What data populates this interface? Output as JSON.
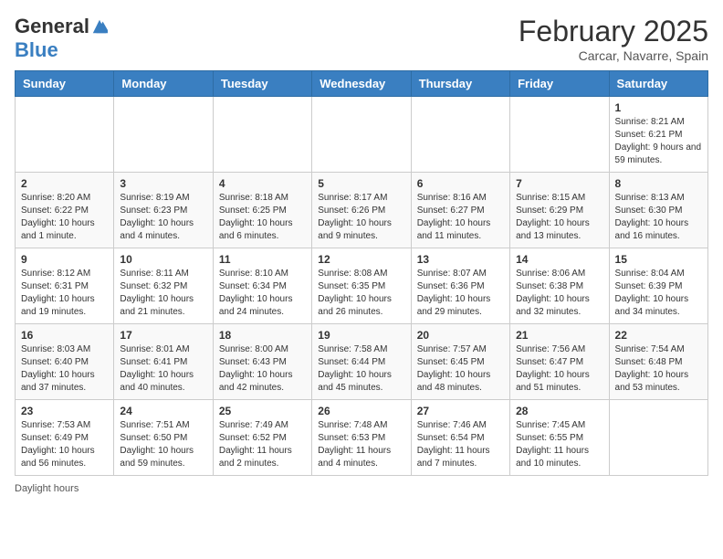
{
  "header": {
    "logo_general": "General",
    "logo_blue": "Blue",
    "month_title": "February 2025",
    "location": "Carcar, Navarre, Spain"
  },
  "calendar": {
    "days_of_week": [
      "Sunday",
      "Monday",
      "Tuesday",
      "Wednesday",
      "Thursday",
      "Friday",
      "Saturday"
    ],
    "weeks": [
      [
        {
          "day": "",
          "info": ""
        },
        {
          "day": "",
          "info": ""
        },
        {
          "day": "",
          "info": ""
        },
        {
          "day": "",
          "info": ""
        },
        {
          "day": "",
          "info": ""
        },
        {
          "day": "",
          "info": ""
        },
        {
          "day": "1",
          "info": "Sunrise: 8:21 AM\nSunset: 6:21 PM\nDaylight: 9 hours and 59 minutes."
        }
      ],
      [
        {
          "day": "2",
          "info": "Sunrise: 8:20 AM\nSunset: 6:22 PM\nDaylight: 10 hours and 1 minute."
        },
        {
          "day": "3",
          "info": "Sunrise: 8:19 AM\nSunset: 6:23 PM\nDaylight: 10 hours and 4 minutes."
        },
        {
          "day": "4",
          "info": "Sunrise: 8:18 AM\nSunset: 6:25 PM\nDaylight: 10 hours and 6 minutes."
        },
        {
          "day": "5",
          "info": "Sunrise: 8:17 AM\nSunset: 6:26 PM\nDaylight: 10 hours and 9 minutes."
        },
        {
          "day": "6",
          "info": "Sunrise: 8:16 AM\nSunset: 6:27 PM\nDaylight: 10 hours and 11 minutes."
        },
        {
          "day": "7",
          "info": "Sunrise: 8:15 AM\nSunset: 6:29 PM\nDaylight: 10 hours and 13 minutes."
        },
        {
          "day": "8",
          "info": "Sunrise: 8:13 AM\nSunset: 6:30 PM\nDaylight: 10 hours and 16 minutes."
        }
      ],
      [
        {
          "day": "9",
          "info": "Sunrise: 8:12 AM\nSunset: 6:31 PM\nDaylight: 10 hours and 19 minutes."
        },
        {
          "day": "10",
          "info": "Sunrise: 8:11 AM\nSunset: 6:32 PM\nDaylight: 10 hours and 21 minutes."
        },
        {
          "day": "11",
          "info": "Sunrise: 8:10 AM\nSunset: 6:34 PM\nDaylight: 10 hours and 24 minutes."
        },
        {
          "day": "12",
          "info": "Sunrise: 8:08 AM\nSunset: 6:35 PM\nDaylight: 10 hours and 26 minutes."
        },
        {
          "day": "13",
          "info": "Sunrise: 8:07 AM\nSunset: 6:36 PM\nDaylight: 10 hours and 29 minutes."
        },
        {
          "day": "14",
          "info": "Sunrise: 8:06 AM\nSunset: 6:38 PM\nDaylight: 10 hours and 32 minutes."
        },
        {
          "day": "15",
          "info": "Sunrise: 8:04 AM\nSunset: 6:39 PM\nDaylight: 10 hours and 34 minutes."
        }
      ],
      [
        {
          "day": "16",
          "info": "Sunrise: 8:03 AM\nSunset: 6:40 PM\nDaylight: 10 hours and 37 minutes."
        },
        {
          "day": "17",
          "info": "Sunrise: 8:01 AM\nSunset: 6:41 PM\nDaylight: 10 hours and 40 minutes."
        },
        {
          "day": "18",
          "info": "Sunrise: 8:00 AM\nSunset: 6:43 PM\nDaylight: 10 hours and 42 minutes."
        },
        {
          "day": "19",
          "info": "Sunrise: 7:58 AM\nSunset: 6:44 PM\nDaylight: 10 hours and 45 minutes."
        },
        {
          "day": "20",
          "info": "Sunrise: 7:57 AM\nSunset: 6:45 PM\nDaylight: 10 hours and 48 minutes."
        },
        {
          "day": "21",
          "info": "Sunrise: 7:56 AM\nSunset: 6:47 PM\nDaylight: 10 hours and 51 minutes."
        },
        {
          "day": "22",
          "info": "Sunrise: 7:54 AM\nSunset: 6:48 PM\nDaylight: 10 hours and 53 minutes."
        }
      ],
      [
        {
          "day": "23",
          "info": "Sunrise: 7:53 AM\nSunset: 6:49 PM\nDaylight: 10 hours and 56 minutes."
        },
        {
          "day": "24",
          "info": "Sunrise: 7:51 AM\nSunset: 6:50 PM\nDaylight: 10 hours and 59 minutes."
        },
        {
          "day": "25",
          "info": "Sunrise: 7:49 AM\nSunset: 6:52 PM\nDaylight: 11 hours and 2 minutes."
        },
        {
          "day": "26",
          "info": "Sunrise: 7:48 AM\nSunset: 6:53 PM\nDaylight: 11 hours and 4 minutes."
        },
        {
          "day": "27",
          "info": "Sunrise: 7:46 AM\nSunset: 6:54 PM\nDaylight: 11 hours and 7 minutes."
        },
        {
          "day": "28",
          "info": "Sunrise: 7:45 AM\nSunset: 6:55 PM\nDaylight: 11 hours and 10 minutes."
        },
        {
          "day": "",
          "info": ""
        }
      ]
    ]
  },
  "footer": {
    "text": "Daylight hours"
  }
}
